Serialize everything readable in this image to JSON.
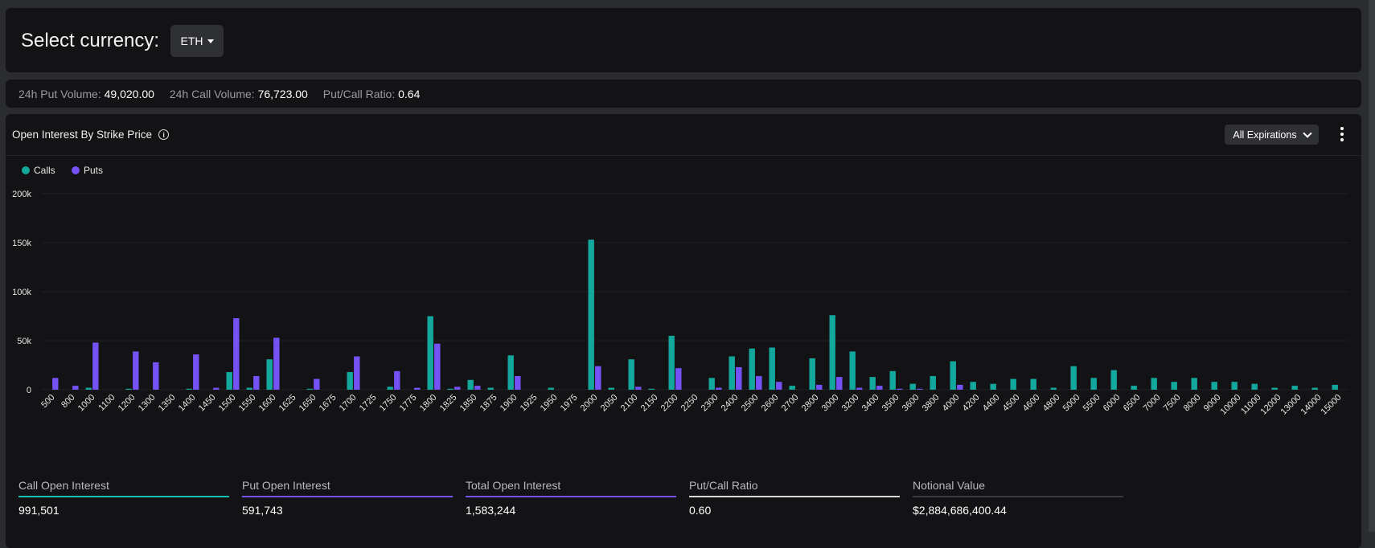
{
  "header": {
    "title": "Select currency:",
    "currency": "ETH"
  },
  "stats": {
    "put_volume_label": "24h Put Volume:",
    "put_volume": "49,020.00",
    "call_volume_label": "24h Call Volume:",
    "call_volume": "76,723.00",
    "ratio_label": "Put/Call Ratio:",
    "ratio": "0.64"
  },
  "panel": {
    "title": "Open Interest By Strike Price",
    "info_glyph": "i",
    "expirations": "All Expirations"
  },
  "colors": {
    "calls": "#13a89e",
    "puts": "#7552f5"
  },
  "chart_data": {
    "type": "bar",
    "title": "",
    "xlabel": "",
    "ylabel": "",
    "ylim": [
      0,
      200000
    ],
    "yticks": [
      {
        "v": 0,
        "label": "0"
      },
      {
        "v": 50000,
        "label": "50k"
      },
      {
        "v": 100000,
        "label": "100k"
      },
      {
        "v": 150000,
        "label": "150k"
      },
      {
        "v": 200000,
        "label": "200k"
      }
    ],
    "legend_position": "top-left",
    "categories": [
      "500",
      "800",
      "1000",
      "1100",
      "1200",
      "1300",
      "1350",
      "1400",
      "1450",
      "1500",
      "1550",
      "1600",
      "1625",
      "1650",
      "1675",
      "1700",
      "1725",
      "1750",
      "1775",
      "1800",
      "1825",
      "1850",
      "1875",
      "1900",
      "1925",
      "1950",
      "1975",
      "2000",
      "2050",
      "2100",
      "2150",
      "2200",
      "2250",
      "2300",
      "2400",
      "2500",
      "2600",
      "2700",
      "2800",
      "3000",
      "3200",
      "3400",
      "3500",
      "3600",
      "3800",
      "4000",
      "4200",
      "4400",
      "4500",
      "4600",
      "4800",
      "5000",
      "5500",
      "6000",
      "6500",
      "7000",
      "7500",
      "8000",
      "9000",
      "10000",
      "11000",
      "12000",
      "13000",
      "14000",
      "15000"
    ],
    "series": [
      {
        "name": "Calls",
        "values": [
          0,
          0,
          2000,
          0,
          1000,
          0,
          0,
          1000,
          0,
          18000,
          2000,
          31000,
          0,
          1000,
          0,
          18000,
          0,
          3000,
          0,
          75000,
          1000,
          10000,
          2000,
          35000,
          0,
          2000,
          0,
          153000,
          2000,
          31000,
          1000,
          55000,
          0,
          12000,
          34000,
          42000,
          43000,
          4000,
          32000,
          76000,
          39000,
          13000,
          19000,
          6000,
          14000,
          29000,
          8000,
          6000,
          11000,
          11000,
          2000,
          24000,
          12000,
          20000,
          4000,
          12000,
          8000,
          12000,
          8000,
          8000,
          6000,
          2000,
          4000,
          2000,
          5000
        ]
      },
      {
        "name": "Puts",
        "values": [
          12000,
          4000,
          48000,
          0,
          39000,
          28000,
          0,
          36000,
          2000,
          73000,
          14000,
          53000,
          0,
          11000,
          0,
          34000,
          0,
          19000,
          2000,
          47000,
          3000,
          4000,
          0,
          14000,
          0,
          0,
          0,
          24000,
          0,
          3000,
          0,
          22000,
          0,
          2000,
          23000,
          14000,
          8000,
          0,
          5000,
          13000,
          2000,
          4000,
          1000,
          1000,
          0,
          5000,
          0,
          0,
          0,
          0,
          0,
          0,
          0,
          0,
          0,
          0,
          0,
          0,
          0,
          0,
          0,
          0,
          0,
          0,
          0
        ]
      }
    ]
  },
  "footer": [
    {
      "label": "Call Open Interest",
      "value": "991,501",
      "color": "#13c2b5"
    },
    {
      "label": "Put Open Interest",
      "value": "591,743",
      "color": "#7552f5"
    },
    {
      "label": "Total Open Interest",
      "value": "1,583,244",
      "color": "#7552f5"
    },
    {
      "label": "Put/Call Ratio",
      "value": "0.60",
      "color": "#d8d8d8"
    },
    {
      "label": "Notional Value",
      "value": "$2,884,686,400.44",
      "color": "#3a3b3e"
    }
  ]
}
